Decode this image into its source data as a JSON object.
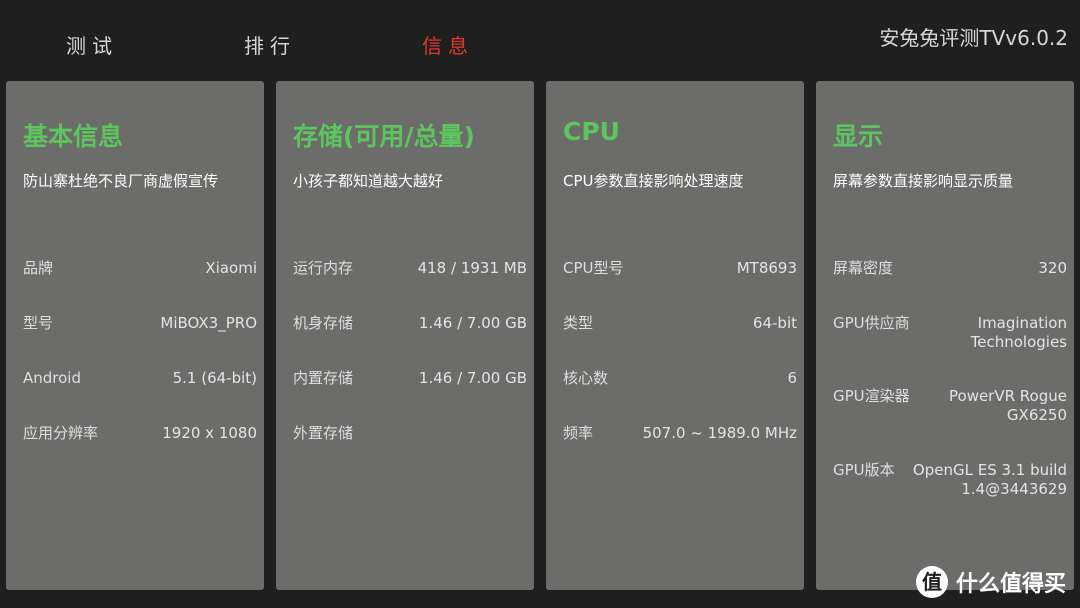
{
  "app_title": "安兔兔评测TVv6.0.2",
  "tabs": [
    {
      "label": "测试",
      "active": false
    },
    {
      "label": "排行",
      "active": false
    },
    {
      "label": "信息",
      "active": true
    }
  ],
  "colors": {
    "accent_green": "#5dc55d",
    "active_tab_red": "#e0392b",
    "card_background": "#6c6c6b",
    "page_background": "#1f1f1f"
  },
  "cards": [
    {
      "title": "基本信息",
      "subtitle": "防山寨杜绝不良厂商虚假宣传",
      "rows": [
        {
          "label": "品牌",
          "value": "Xiaomi"
        },
        {
          "label": "型号",
          "value": "MiBOX3_PRO"
        },
        {
          "label": "Android",
          "value": "5.1 (64-bit)"
        },
        {
          "label": "应用分辨率",
          "value": "1920 x 1080"
        }
      ]
    },
    {
      "title": "存储(可用/总量)",
      "subtitle": "小孩子都知道越大越好",
      "rows": [
        {
          "label": "运行内存",
          "value": "418 / 1931 MB"
        },
        {
          "label": "机身存储",
          "value": "1.46 / 7.00 GB"
        },
        {
          "label": "内置存储",
          "value": "1.46 / 7.00 GB"
        },
        {
          "label": "外置存储",
          "value": ""
        }
      ]
    },
    {
      "title": "CPU",
      "subtitle": "CPU参数直接影响处理速度",
      "rows": [
        {
          "label": "CPU型号",
          "value": "MT8693"
        },
        {
          "label": "类型",
          "value": "64-bit"
        },
        {
          "label": "核心数",
          "value": "6"
        },
        {
          "label": "频率",
          "value": "507.0 ~ 1989.0 MHz"
        }
      ]
    },
    {
      "title": "显示",
      "subtitle": "屏幕参数直接影响显示质量",
      "rows": [
        {
          "label": "屏幕密度",
          "value": "320"
        },
        {
          "label": "GPU供应商",
          "value": "Imagination\nTechnologies"
        },
        {
          "label": "GPU渲染器",
          "value": "PowerVR Rogue\nGX6250"
        },
        {
          "label": "GPU版本",
          "value": "OpenGL ES 3.1 build\n1.4@3443629"
        }
      ]
    }
  ],
  "watermark": {
    "icon": "值",
    "text": "什么值得买"
  }
}
